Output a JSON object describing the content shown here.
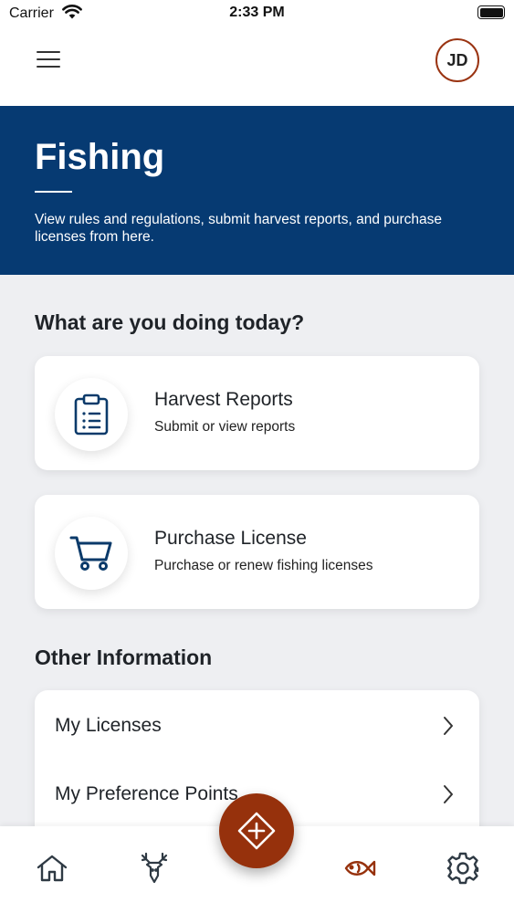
{
  "status_bar": {
    "carrier": "Carrier",
    "time": "2:33 PM"
  },
  "header": {
    "avatar_initials": "JD"
  },
  "hero": {
    "title": "Fishing",
    "description": "View rules and regulations, submit harvest reports, and purchase licenses from here."
  },
  "actions": {
    "heading": "What are you doing today?",
    "items": [
      {
        "title": "Harvest Reports",
        "subtitle": "Submit or view reports",
        "icon": "clipboard-list-icon"
      },
      {
        "title": "Purchase License",
        "subtitle": "Purchase or renew fishing licenses",
        "icon": "shopping-cart-icon"
      }
    ]
  },
  "other_info": {
    "heading": "Other Information",
    "items": [
      {
        "label": "My Licenses"
      },
      {
        "label": "My Preference Points"
      }
    ]
  },
  "tab_bar": {
    "items": [
      "home-icon",
      "deer-icon",
      "fish-icon",
      "gear-icon"
    ],
    "active": "fish-icon"
  },
  "colors": {
    "hero_bg": "#063a72",
    "accent": "#96310c",
    "icon_blue": "#0b3a6a",
    "page_bg": "#eeeff2"
  }
}
